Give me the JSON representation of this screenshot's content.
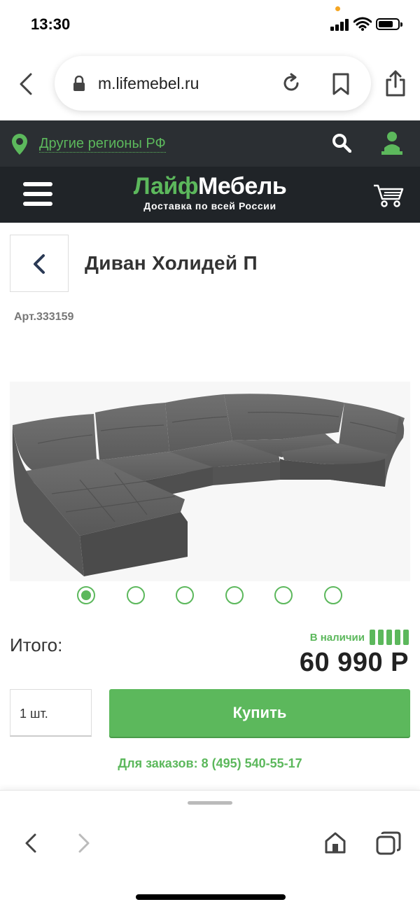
{
  "status_bar": {
    "time": "13:30"
  },
  "browser": {
    "url": "m.lifemebel.ru"
  },
  "site": {
    "region_link": "Другие регионы РФ",
    "logo_part1": "Лайф",
    "logo_part2": "Мебель",
    "logo_tagline": "Доставка по всей России",
    "brand_color": "#5cb85c",
    "header_color": "#202428"
  },
  "product": {
    "title": "Диван Холидей П",
    "article": "Арт.333159",
    "image_count": 6,
    "active_image": 1
  },
  "purchase": {
    "total_label": "Итого:",
    "stock_status": "В наличии",
    "stock_level": 5,
    "price": "60 990 Р",
    "quantity": "1 шт.",
    "buy_label": "Купить",
    "order_phone": "Для заказов: 8 (495) 540-55-17"
  },
  "icons": [
    "back-icon",
    "lock-icon",
    "reload-icon",
    "bookmark-icon",
    "share-icon",
    "location-pin-icon",
    "search-icon",
    "user-icon",
    "menu-icon",
    "cart-icon",
    "chevron-left-icon",
    "home-icon",
    "tabs-icon"
  ]
}
